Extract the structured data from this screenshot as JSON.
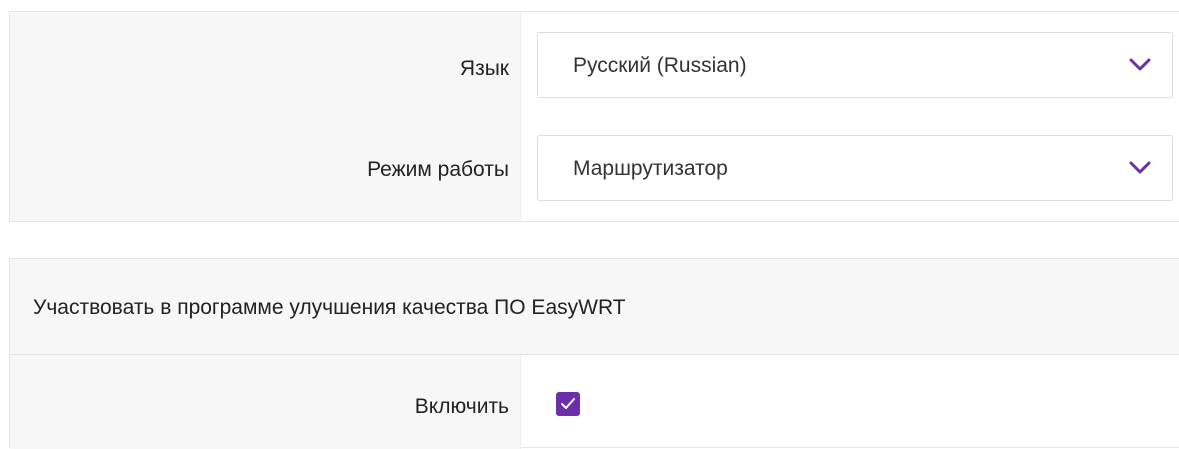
{
  "settings": {
    "language": {
      "label": "Язык",
      "value": "Русский (Russian)",
      "icon": "chevron-down-icon"
    },
    "mode": {
      "label": "Режим работы",
      "value": "Маршрутизатор",
      "icon": "chevron-down-icon"
    }
  },
  "quality_program": {
    "title": "Участвовать в программе улучшения качества ПО EasyWRT",
    "enable": {
      "label": "Включить",
      "checked": true,
      "icon": "checkmark-icon"
    }
  },
  "colors": {
    "accent": "#6b2fa8",
    "label_background": "#f7f7f7",
    "border": "#e6e6e6"
  }
}
